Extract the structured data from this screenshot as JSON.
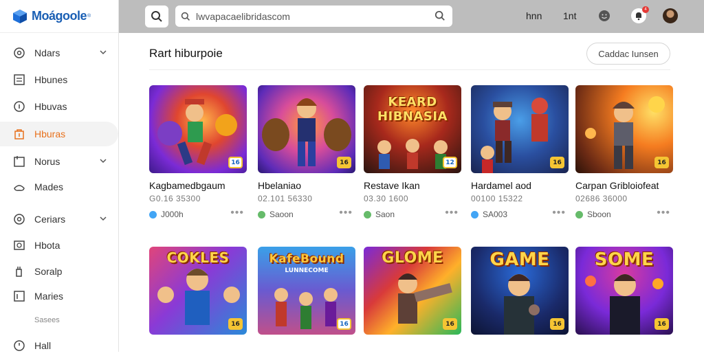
{
  "app": {
    "logo_text": "Moágoole",
    "logo_mark": "®"
  },
  "sidebar": {
    "items": [
      {
        "label": "Ndars",
        "icon": "settings-icon",
        "chevron": true
      },
      {
        "label": "Hbunes",
        "icon": "document-icon",
        "chevron": false
      },
      {
        "label": "Hbuvas",
        "icon": "info-icon",
        "chevron": false
      },
      {
        "label": "Hburas",
        "icon": "bag-icon",
        "chevron": false,
        "active": true
      },
      {
        "label": "Norus",
        "icon": "folder-icon",
        "chevron": true
      },
      {
        "label": "Mades",
        "icon": "controller-icon",
        "chevron": false
      },
      {
        "label": "Ceriars",
        "icon": "settings-icon",
        "chevron": true
      },
      {
        "label": "Hbota",
        "icon": "camera-icon",
        "chevron": false
      },
      {
        "label": "Soralp",
        "icon": "spray-icon",
        "chevron": false
      },
      {
        "label": "Maries",
        "icon": "list-icon",
        "chevron": false
      },
      {
        "label": "Hall",
        "icon": "clock-icon",
        "chevron": false
      }
    ],
    "section_label": "Sasees"
  },
  "topbar": {
    "search_value": "lwvapacaelibridascom",
    "link1": "hnn",
    "link2": "1nt",
    "notification_count": "4"
  },
  "main": {
    "title": "Rart hiburpoie",
    "action_button": "Caddac Iunsen"
  },
  "row1": [
    {
      "title": "Kagbamedbgaum",
      "meta": "G0.16 35300",
      "foot": "J000h",
      "dot": "#42a5f5",
      "age": "16",
      "thumb_word": "",
      "theme": "purple"
    },
    {
      "title": "Hbelaniao",
      "meta": "02.101 56330",
      "foot": "Saoon",
      "dot": "#66bb6a",
      "age": "16",
      "thumb_word": "",
      "theme": "violet"
    },
    {
      "title": "Restave Ikan",
      "meta": "03.30 1600",
      "foot": "Saon",
      "dot": "#66bb6a",
      "age": "12",
      "thumb_word": "KEARD HIBNASIA",
      "theme": "dark"
    },
    {
      "title": "Hardamel aod",
      "meta": "00100 15322",
      "foot": "SA003",
      "dot": "#42a5f5",
      "age": "16",
      "thumb_word": "",
      "theme": "blue"
    },
    {
      "title": "Carpan Gribloiofeat",
      "meta": "02686 36000",
      "foot": "Sboon",
      "dot": "#66bb6a",
      "age": "16",
      "thumb_word": "",
      "theme": "orange"
    }
  ],
  "row2": [
    {
      "thumb_word": "COKLES",
      "age": "16",
      "theme": "pinkblue"
    },
    {
      "thumb_word": "KafeBound",
      "thumb_sub": "LUNNECOME",
      "age": "16",
      "theme": "street"
    },
    {
      "thumb_word": "GLOME",
      "age": "16",
      "theme": "rainbow"
    },
    {
      "thumb_word": "GAME",
      "age": "16",
      "theme": "navy"
    },
    {
      "thumb_word": "SOME",
      "age": "16",
      "theme": "magenta"
    }
  ],
  "colors": {
    "accent": "#e8711c",
    "topbar": "#bdbdbd",
    "link": "#1a5fb4"
  }
}
